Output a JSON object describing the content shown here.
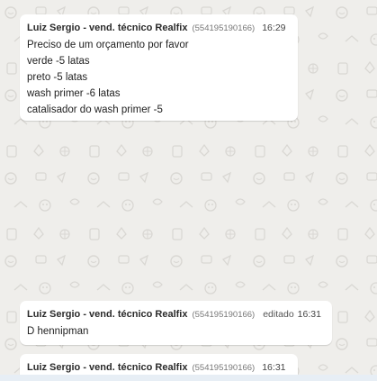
{
  "messages": [
    {
      "sender": "Luiz Sergio - vend. técnico Realfix",
      "phone": "(554195190166)",
      "edited": "",
      "time": "16:29",
      "lines": [
        "Preciso de um orçamento por favor",
        "verde -5 latas",
        "preto -5 latas",
        "wash primer -6 latas",
        "catalisador do wash primer -5"
      ]
    },
    {
      "sender": "Luiz Sergio - vend. técnico Realfix",
      "phone": "(554195190166)",
      "edited": "editado",
      "time": "16:31",
      "lines": [
        "D hennipman"
      ]
    },
    {
      "sender": "Luiz Sergio - vend. técnico Realfix",
      "phone": "(554195190166)",
      "edited": "",
      "time": "16:31",
      "lines": []
    }
  ],
  "colors": {
    "chat_background": "#efeeeb",
    "bubble_background": "#ffffff",
    "pattern_color": "#c9c7c2"
  },
  "icons": {
    "background_pattern": "doodle-pattern-icon"
  }
}
